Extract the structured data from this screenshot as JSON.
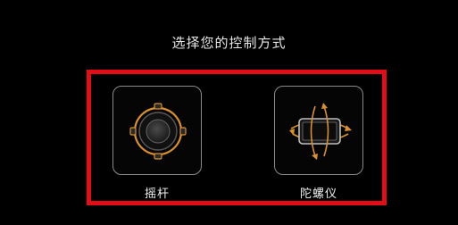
{
  "dialog": {
    "title": "选择您的控制方式"
  },
  "options": [
    {
      "id": "joystick",
      "label": "摇杆",
      "icon": "joystick-icon"
    },
    {
      "id": "gyro",
      "label": "陀螺仪",
      "icon": "gyroscope-phone-icon"
    }
  ],
  "colors": {
    "background": "#000000",
    "highlight": "#e30d18",
    "accent": "#d9902e",
    "card_border": "#8a8a8a"
  }
}
